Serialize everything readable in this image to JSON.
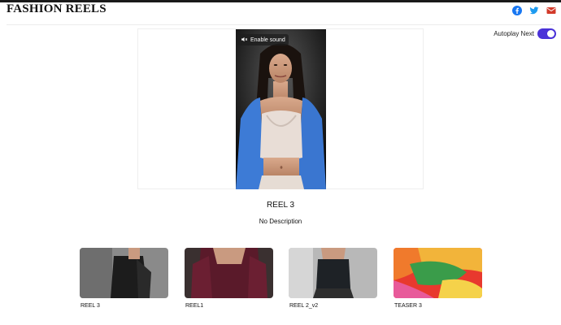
{
  "header": {
    "brand": "FASHION REELS",
    "social": [
      {
        "icon": "facebook-icon",
        "color": "#1877f2"
      },
      {
        "icon": "twitter-icon",
        "color": "#1d9bf0"
      },
      {
        "icon": "mail-icon",
        "color": "#d23a2a"
      }
    ]
  },
  "autoplay": {
    "label": "Autoplay Next",
    "enabled": true,
    "accent": "#4a32d8"
  },
  "player": {
    "sound_label": "Enable sound"
  },
  "current": {
    "title": "REEL 3",
    "description": "No Description"
  },
  "thumbnails": [
    {
      "label": "REEL 3"
    },
    {
      "label": "REEL1"
    },
    {
      "label": "REEL 2_v2"
    },
    {
      "label": "TEASER 3"
    }
  ]
}
